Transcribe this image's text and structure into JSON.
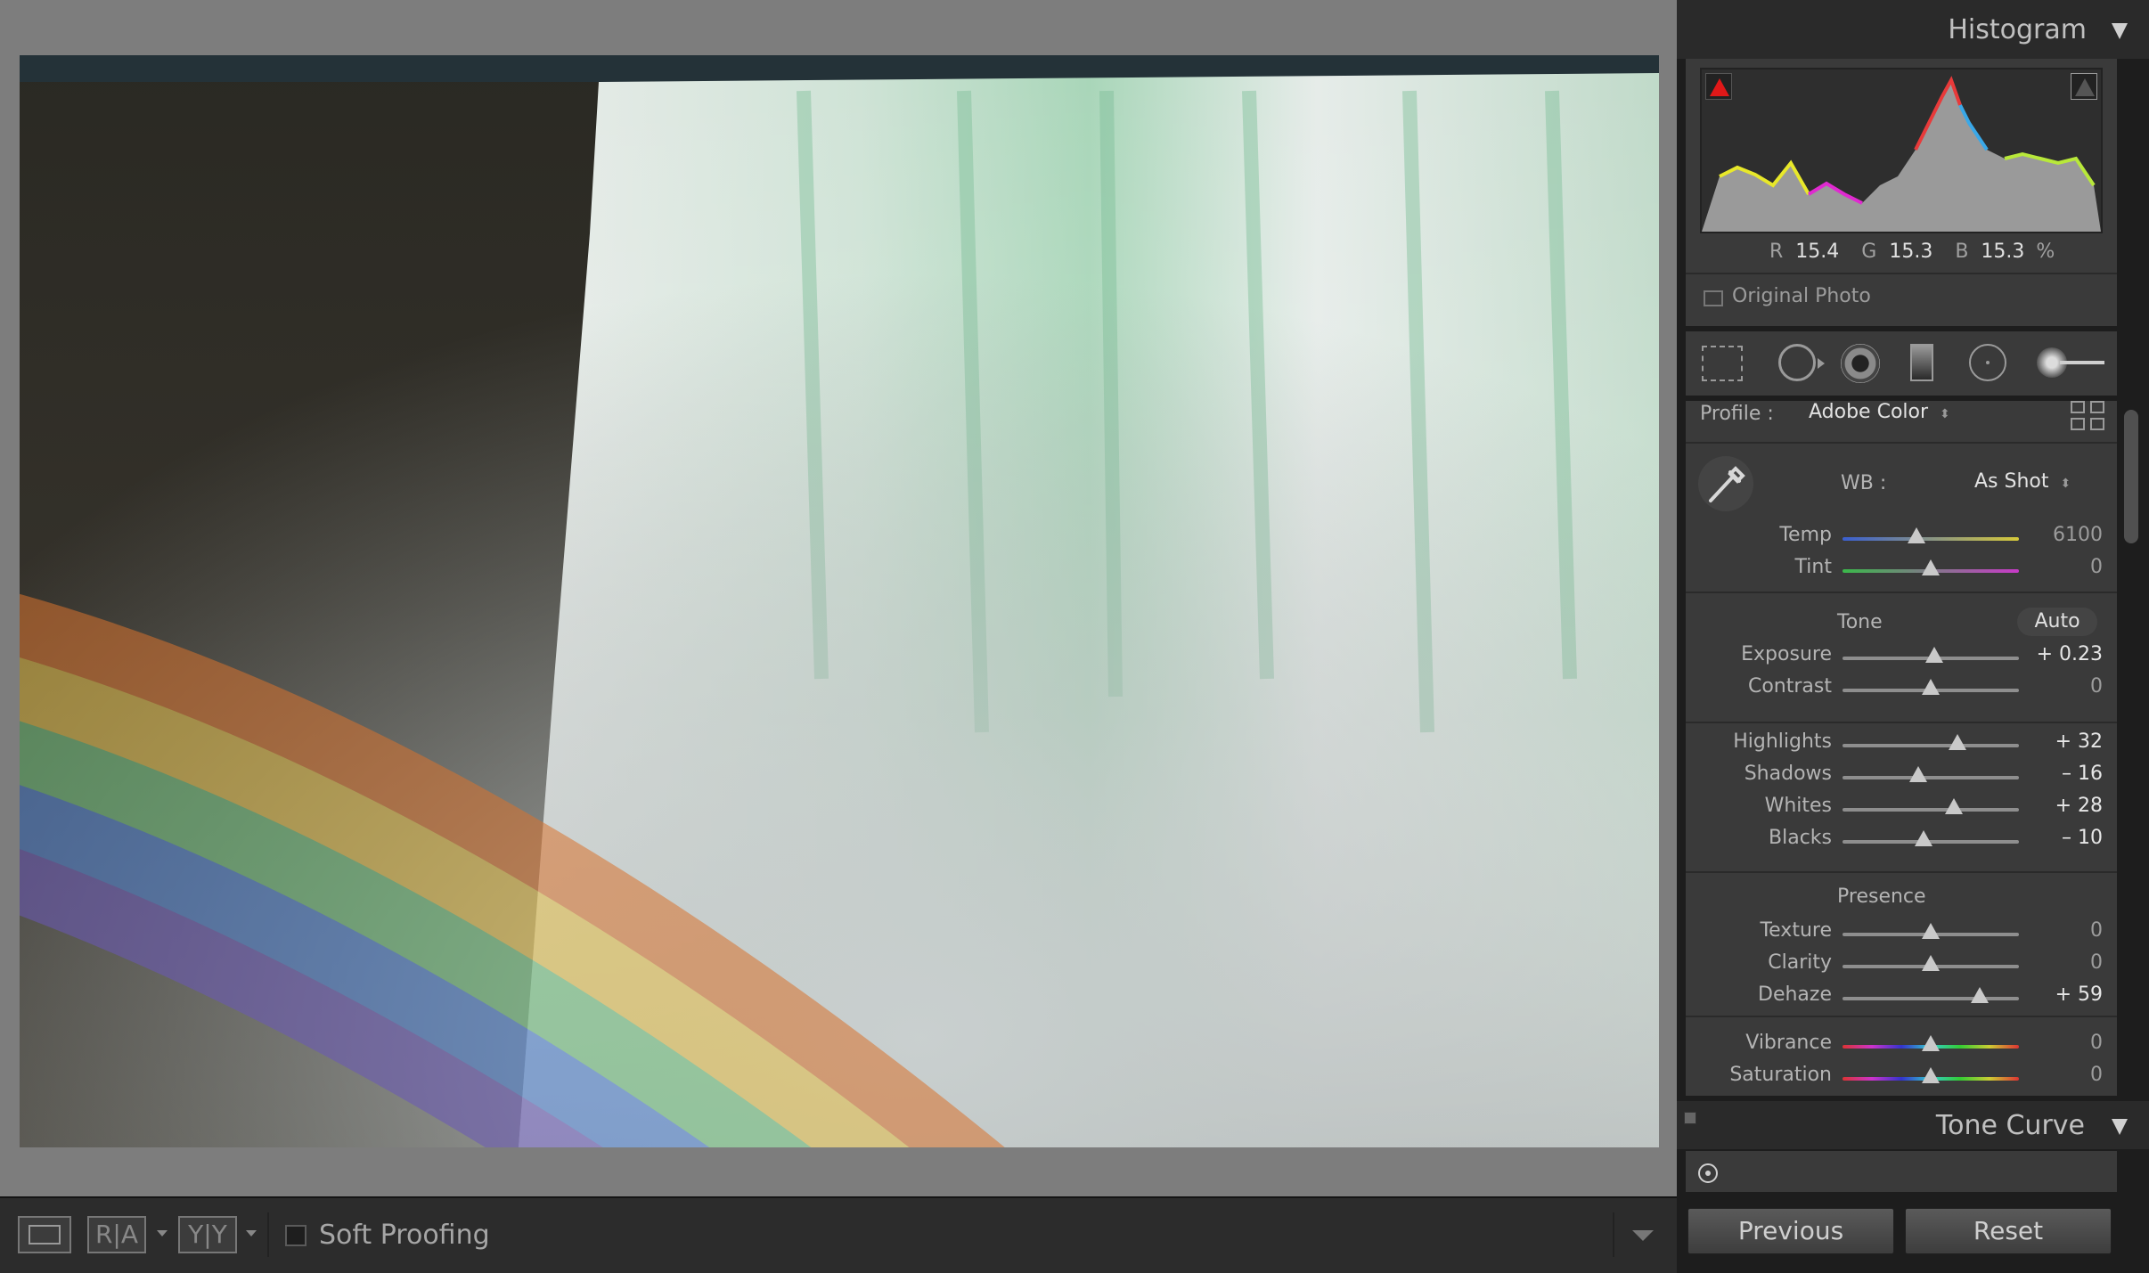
{
  "histogram": {
    "title": "Histogram",
    "r_label": "R",
    "r_value": "15.4",
    "g_label": "G",
    "g_value": "15.3",
    "b_label": "B",
    "b_value": "15.3",
    "unit": "%",
    "original_photo": "Original Photo"
  },
  "basic": {
    "profile_label": "Profile :",
    "profile_value": "Adobe Color",
    "wb_label": "WB :",
    "wb_value": "As Shot",
    "tone_label": "Tone",
    "auto_label": "Auto",
    "presence_label": "Presence",
    "sliders": [
      {
        "name": "Temp",
        "value": "6100",
        "level": 0.42,
        "highlight": false,
        "track": "temp"
      },
      {
        "name": "Tint",
        "value": "0",
        "level": 0.5,
        "highlight": false,
        "track": "tint"
      },
      {
        "name": "Exposure",
        "value": "+ 0.23",
        "level": 0.52,
        "highlight": true,
        "track": "gray"
      },
      {
        "name": "Contrast",
        "value": "0",
        "level": 0.5,
        "highlight": false,
        "track": "gray"
      },
      {
        "name": "Highlights",
        "value": "+ 32",
        "level": 0.65,
        "highlight": true,
        "track": "gray"
      },
      {
        "name": "Shadows",
        "value": "– 16",
        "level": 0.43,
        "highlight": true,
        "track": "gray"
      },
      {
        "name": "Whites",
        "value": "+ 28",
        "level": 0.63,
        "highlight": true,
        "track": "gray"
      },
      {
        "name": "Blacks",
        "value": "– 10",
        "level": 0.46,
        "highlight": true,
        "track": "gray"
      },
      {
        "name": "Texture",
        "value": "0",
        "level": 0.5,
        "highlight": false,
        "track": "gray"
      },
      {
        "name": "Clarity",
        "value": "0",
        "level": 0.5,
        "highlight": false,
        "track": "gray"
      },
      {
        "name": "Dehaze",
        "value": "+ 59",
        "level": 0.78,
        "highlight": true,
        "track": "gray"
      },
      {
        "name": "Vibrance",
        "value": "0",
        "level": 0.5,
        "highlight": false,
        "track": "sat"
      },
      {
        "name": "Saturation",
        "value": "0",
        "level": 0.5,
        "highlight": false,
        "track": "sat"
      }
    ]
  },
  "tone_curve": {
    "title": "Tone Curve"
  },
  "buttons": {
    "previous": "Previous",
    "reset": "Reset"
  },
  "toolbar": {
    "soft_proofing": "Soft Proofing",
    "compare_ra": "R|A",
    "compare_yy": "Y|Y"
  },
  "colors": {
    "panel_bg": "#3a3a3a",
    "stage_bg": "#7d7d7d",
    "highlight_text": "#e6e6e6"
  }
}
